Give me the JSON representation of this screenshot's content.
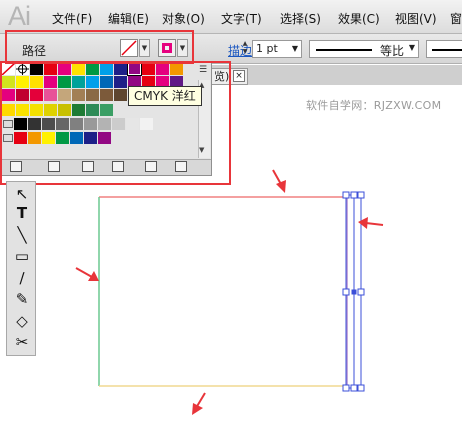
{
  "app": {
    "logo": "Ai"
  },
  "menu": [
    "文件(F)",
    "编辑(E)",
    "对象(O)",
    "文字(T)",
    "选择(S)",
    "效果(C)",
    "视图(V)",
    "窗"
  ],
  "control": {
    "selection_label": "路径",
    "stroke_label": "描边:",
    "stroke_weight": "1 pt",
    "stroke_profile": "等比"
  },
  "document_tab": {
    "label": "览)",
    "close": "×"
  },
  "tooltip": "CMYK 洋红",
  "watermark": "软件自学网：RJZXW.COM",
  "colors": {
    "highlight": "#e8353a",
    "fill_swatch": "#e6007e",
    "selection_blue": "#3b4fd8"
  },
  "swatch_rows": [
    [
      "#ffffff",
      "#ffffff",
      "#000000",
      "#e60012",
      "#e6007e",
      "#ffe100",
      "#009944",
      "#00a0e9",
      "#1d2088",
      "#920783",
      "#e60012",
      "#e4007f",
      "#f39800"
    ],
    [
      "#d2e31e",
      "#fff100",
      "#ffe100",
      "#e4007f",
      "#009944",
      "#00a29a",
      "#00a0e9",
      "#0068b7",
      "#1d2088",
      "#920783",
      "#e60012",
      "#e5007f",
      "#601986"
    ],
    [
      "#e4007f",
      "#c00030",
      "#e4003a",
      "#e85298",
      "#c4a67b",
      "#a27f55",
      "#8a6a45",
      "#7c5a3a",
      "#5e4630",
      "#7f6f55",
      "#6b4c2a",
      "#a0522d",
      "#7a4c1f"
    ],
    [
      "#ffd900",
      "#fbe300",
      "#f4e100",
      "#dfd200",
      "#c8c000",
      "#1e7b34",
      "#2e8b57",
      "#3a9e64"
    ],
    [
      "#000000",
      "#333333",
      "#4d4d4d",
      "#666666",
      "#808080",
      "#999999",
      "#b3b3b3",
      "#cccccc",
      "#e6e6e6",
      "#f2f2f2"
    ],
    [
      "#e60012",
      "#f39800",
      "#fff100",
      "#009944",
      "#0068b7",
      "#1d2088",
      "#920783"
    ]
  ],
  "tools": [
    "selection-tool",
    "type-tool",
    "line-tool",
    "rectangle-tool",
    "brush-tool",
    "pencil-tool",
    "eraser-tool",
    "scissors-tool"
  ]
}
